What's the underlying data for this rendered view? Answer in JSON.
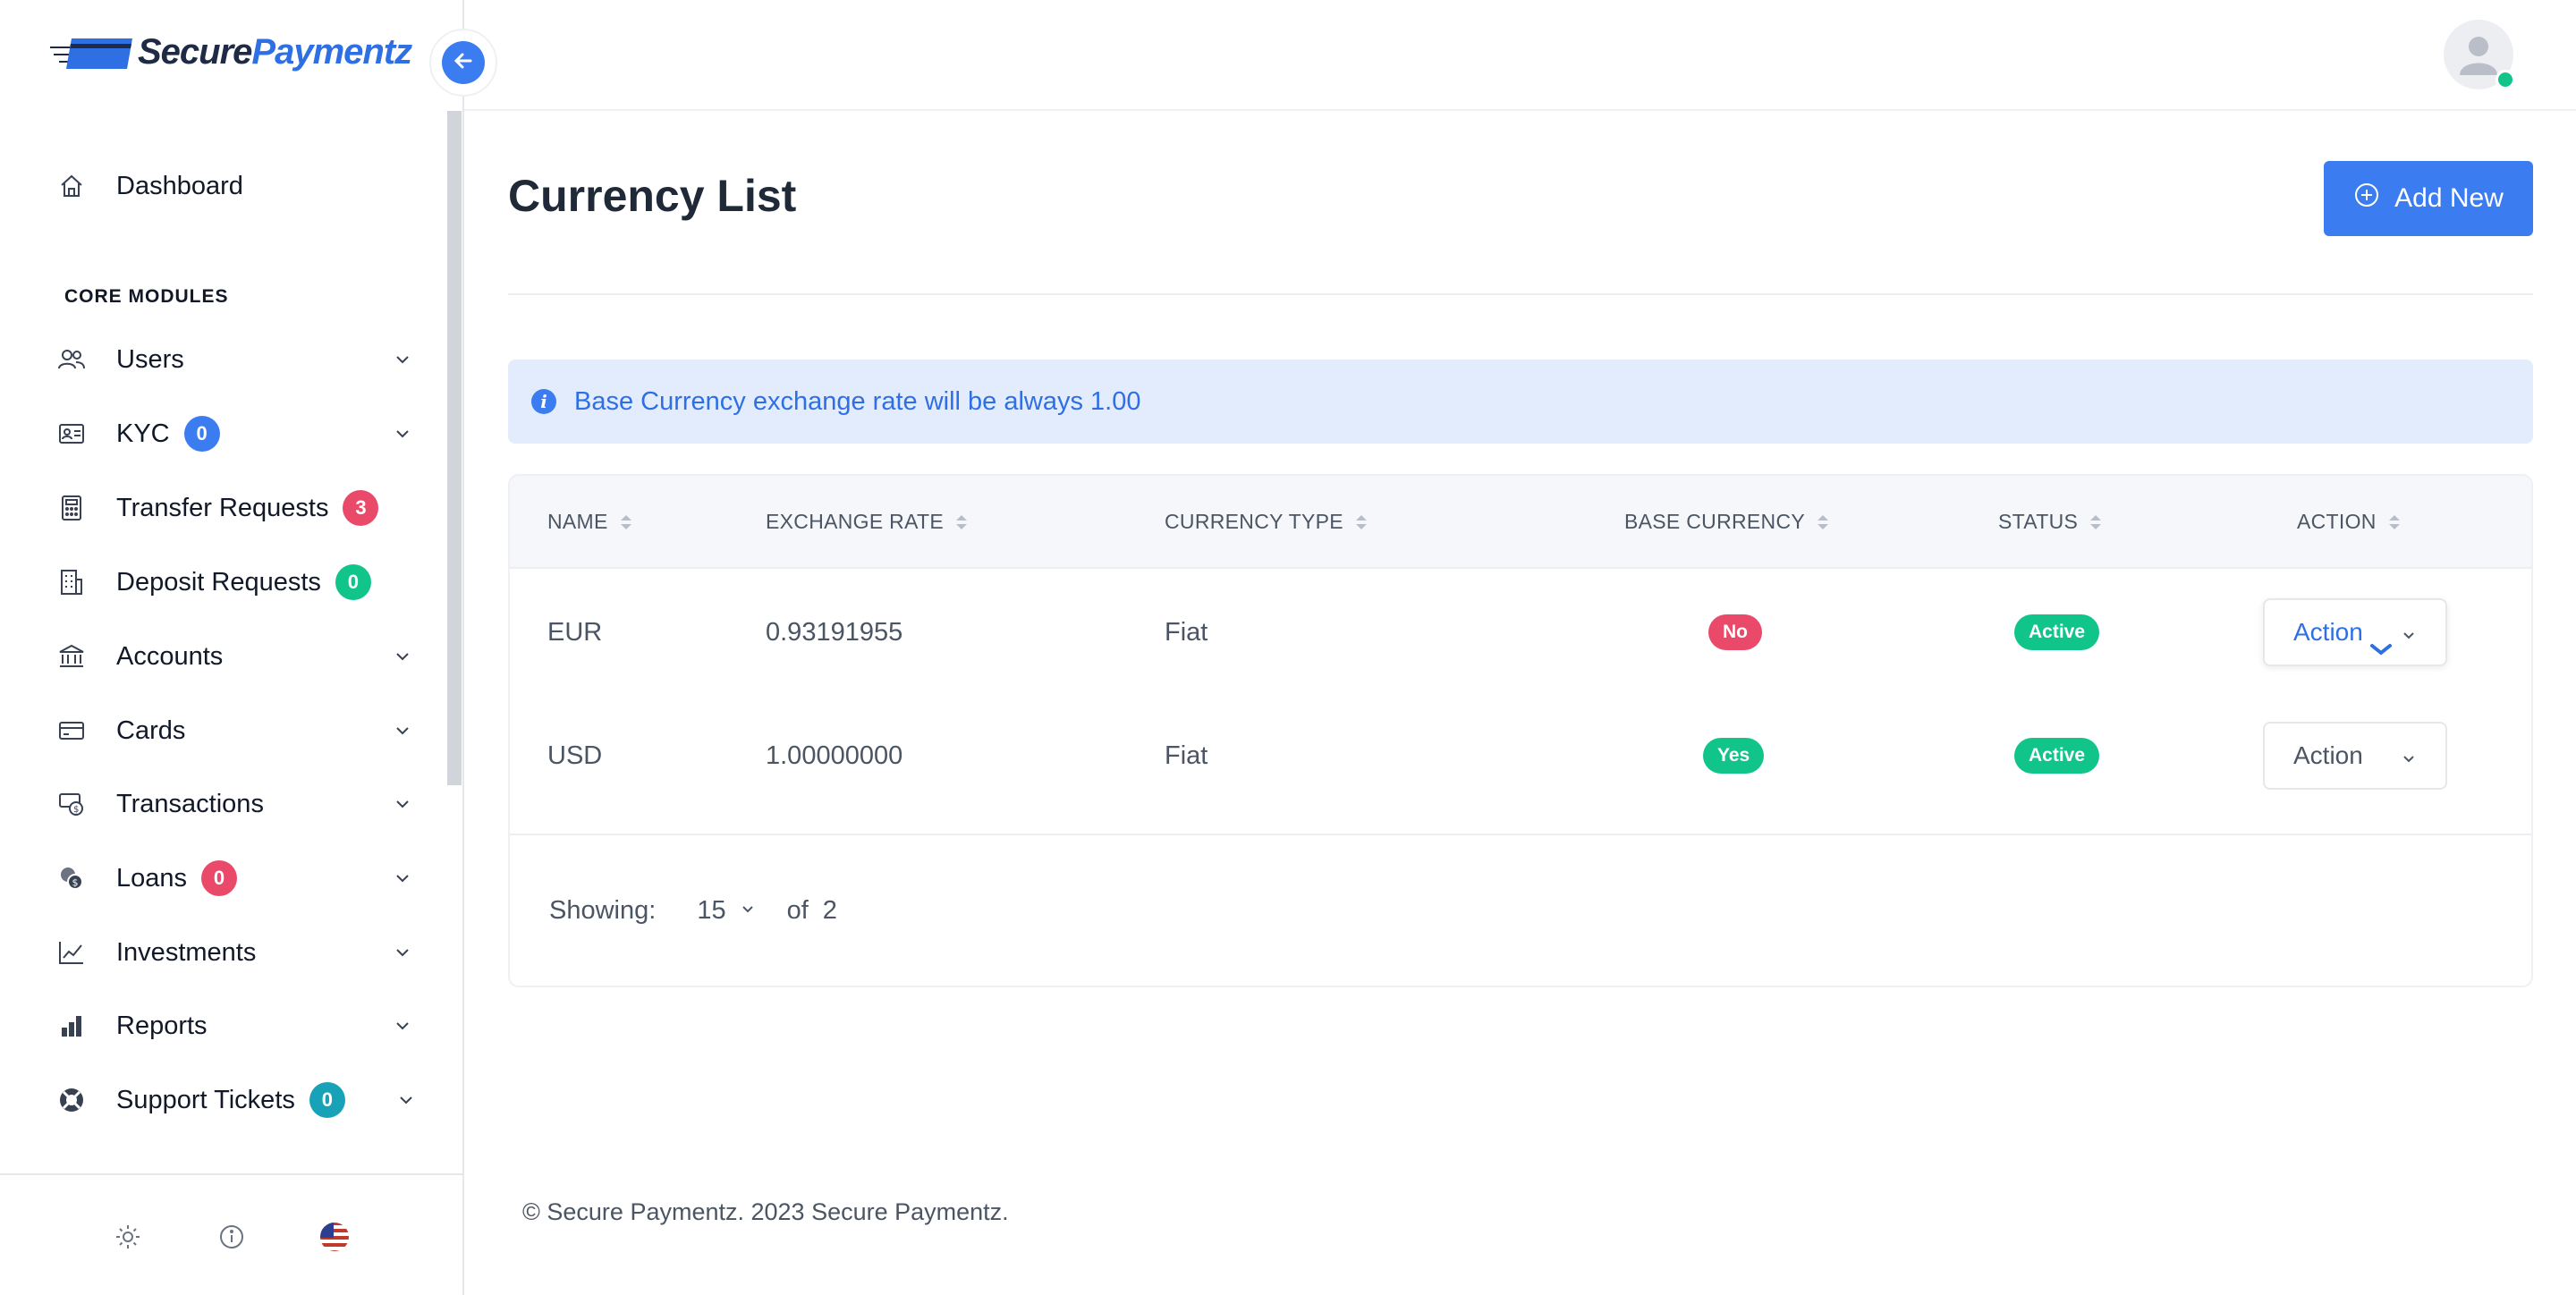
{
  "brand": {
    "name_part1": "Secure",
    "name_part2": "Paymentz",
    "accent": "#2f6fe4"
  },
  "sidebar": {
    "collapse_icon": "arrow-left-icon",
    "section_title": "CORE MODULES",
    "items": [
      {
        "label": "Dashboard",
        "icon": "home-icon"
      },
      {
        "label": "Users",
        "icon": "users-icon",
        "expandable": true
      },
      {
        "label": "KYC",
        "icon": "id-card-icon",
        "badge": "0",
        "badge_color": "#3b7df0",
        "expandable": true
      },
      {
        "label": "Transfer Requests",
        "icon": "calculator-icon",
        "badge": "3",
        "badge_color": "#ea4a6a"
      },
      {
        "label": "Deposit Requests",
        "icon": "building-icon",
        "badge": "0",
        "badge_color": "#10c48a"
      },
      {
        "label": "Accounts",
        "icon": "bank-icon",
        "expandable": true
      },
      {
        "label": "Cards",
        "icon": "credit-card-icon",
        "expandable": true
      },
      {
        "label": "Transactions",
        "icon": "money-transfer-icon",
        "expandable": true
      },
      {
        "label": "Loans",
        "icon": "coins-icon",
        "badge": "0",
        "badge_color": "#ea4a6a",
        "expandable": true
      },
      {
        "label": "Investments",
        "icon": "chart-line-icon",
        "expandable": true
      },
      {
        "label": "Reports",
        "icon": "bar-chart-icon",
        "expandable": true
      },
      {
        "label": "Support Tickets",
        "icon": "lifebuoy-icon",
        "badge": "0",
        "badge_color": "#17a2b8",
        "expandable": true
      }
    ],
    "footer_icons": [
      "sun-icon",
      "info-icon",
      "us-flag-icon"
    ]
  },
  "header": {
    "avatar_status_color": "#10c48a"
  },
  "page": {
    "title": "Currency List",
    "add_button_label": "Add New",
    "alert_text": "Base Currency exchange rate will be always 1.00"
  },
  "table": {
    "columns": [
      "NAME",
      "EXCHANGE RATE",
      "CURRENCY TYPE",
      "BASE CURRENCY",
      "STATUS",
      "ACTION"
    ],
    "rows": [
      {
        "name": "EUR",
        "exchange_rate": "0.93191955",
        "currency_type": "Fiat",
        "base_currency": "No",
        "status": "Active",
        "action": "Action"
      },
      {
        "name": "USD",
        "exchange_rate": "1.00000000",
        "currency_type": "Fiat",
        "base_currency": "Yes",
        "status": "Active",
        "action": "Action"
      }
    ],
    "pagination": {
      "showing_label": "Showing:",
      "per_page": "15",
      "of_label": "of",
      "total": "2"
    }
  },
  "footer": {
    "copyright": "© Secure Paymentz. 2023 Secure Paymentz."
  }
}
